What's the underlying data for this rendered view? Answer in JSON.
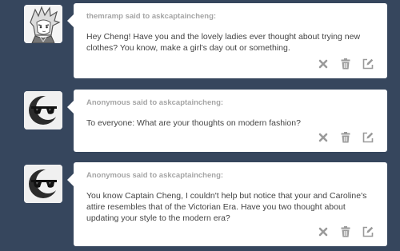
{
  "colors": {
    "background": "#36465d",
    "card": "#ffffff",
    "asker_text": "#a5a5a5",
    "question_text": "#444444",
    "control_icon": "#9a9a9a"
  },
  "messages": [
    {
      "avatar": "anime-boy-avatar",
      "asker": "themramp said to askcaptaincheng:",
      "text": "Hey Cheng! Have you and the lovely ladies ever thought about trying new clothes? You know, make a girl's day out or something.",
      "controls": [
        "delete-x-icon",
        "trash-icon",
        "edit-pencil-icon"
      ]
    },
    {
      "avatar": "anonymous-sunglasses-avatar",
      "asker": "Anonymous said to askcaptaincheng:",
      "text": "To everyone: What are your thoughts on modern fashion?",
      "controls": [
        "delete-x-icon",
        "trash-icon",
        "edit-pencil-icon"
      ]
    },
    {
      "avatar": "anonymous-sunglasses-avatar",
      "asker": "Anonymous said to askcaptaincheng:",
      "text": "You know Captain Cheng, I couldn't help but notice that your and Caroline's attire resembles that of the Victorian Era. Have you two thought about updating your style to the modern era?",
      "controls": [
        "delete-x-icon",
        "trash-icon",
        "edit-pencil-icon"
      ]
    }
  ]
}
